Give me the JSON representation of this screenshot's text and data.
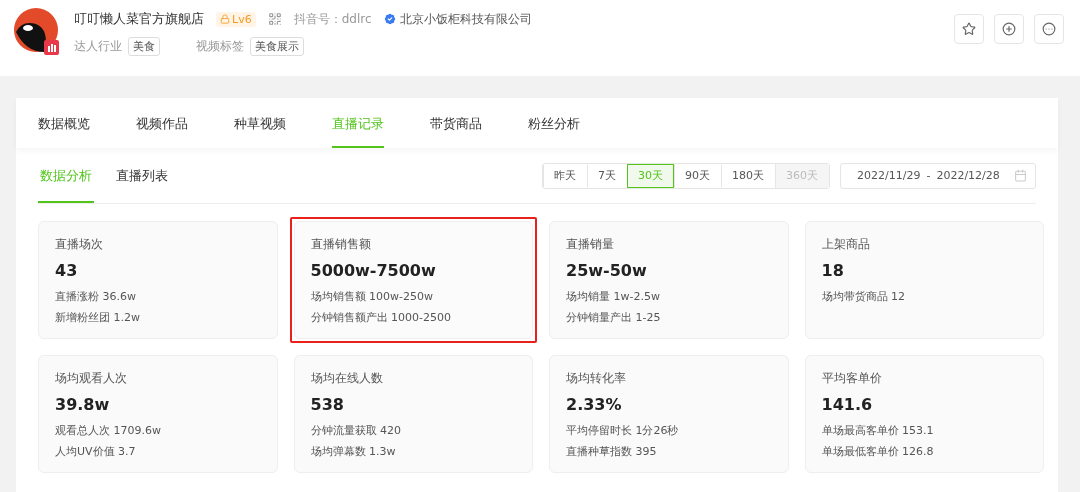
{
  "header": {
    "shop_name": "叮叮懒人菜官方旗舰店",
    "level": "Lv6",
    "douyin_id": "抖音号：ddlrc",
    "company": "北京小饭柜科技有限公司",
    "meta": [
      {
        "label": "达人行业",
        "tag": "美食"
      },
      {
        "label": "视频标签",
        "tag": "美食展示"
      }
    ]
  },
  "tabs": [
    {
      "label": "数据概览",
      "selected": false
    },
    {
      "label": "视频作品",
      "selected": false
    },
    {
      "label": "种草视频",
      "selected": false
    },
    {
      "label": "直播记录",
      "selected": true
    },
    {
      "label": "带货商品",
      "selected": false
    },
    {
      "label": "粉丝分析",
      "selected": false
    }
  ],
  "sub_tabs": [
    {
      "label": "数据分析",
      "selected": true
    },
    {
      "label": "直播列表",
      "selected": false
    }
  ],
  "ranges": [
    {
      "label": "昨天",
      "selected": false,
      "disabled": false
    },
    {
      "label": "7天",
      "selected": false,
      "disabled": false
    },
    {
      "label": "30天",
      "selected": true,
      "disabled": false
    },
    {
      "label": "90天",
      "selected": false,
      "disabled": false
    },
    {
      "label": "180天",
      "selected": false,
      "disabled": false
    },
    {
      "label": "360天",
      "selected": false,
      "disabled": true
    }
  ],
  "date_range": {
    "start": "2022/11/29",
    "separator": "-",
    "end": "2022/12/28"
  },
  "cards": [
    {
      "title": "直播场次",
      "value": "43",
      "highlighted": false,
      "lines": [
        "直播涨粉 36.6w",
        "新增粉丝团 1.2w"
      ]
    },
    {
      "title": "直播销售额",
      "value": "5000w-7500w",
      "highlighted": true,
      "lines": [
        "场均销售额 100w-250w",
        "分钟销售额产出 1000-2500"
      ]
    },
    {
      "title": "直播销量",
      "value": "25w-50w",
      "highlighted": false,
      "lines": [
        "场均销量 1w-2.5w",
        "分钟销量产出 1-25"
      ]
    },
    {
      "title": "上架商品",
      "value": "18",
      "highlighted": false,
      "lines": [
        "场均带货商品 12"
      ]
    },
    {
      "title": "场均观看人次",
      "value": "39.8w",
      "highlighted": false,
      "lines": [
        "观看总人次 1709.6w",
        "人均UV价值 3.7"
      ]
    },
    {
      "title": "场均在线人数",
      "value": "538",
      "highlighted": false,
      "lines": [
        "分钟流量获取 420",
        "场均弹幕数 1.3w"
      ]
    },
    {
      "title": "场均转化率",
      "value": "2.33%",
      "highlighted": false,
      "lines": [
        "平均停留时长 1分26秒",
        "直播种草指数 395"
      ]
    },
    {
      "title": "平均客单价",
      "value": "141.6",
      "highlighted": false,
      "lines": [
        "单场最高客单价 153.1",
        "单场最低客单价 126.8"
      ]
    }
  ]
}
